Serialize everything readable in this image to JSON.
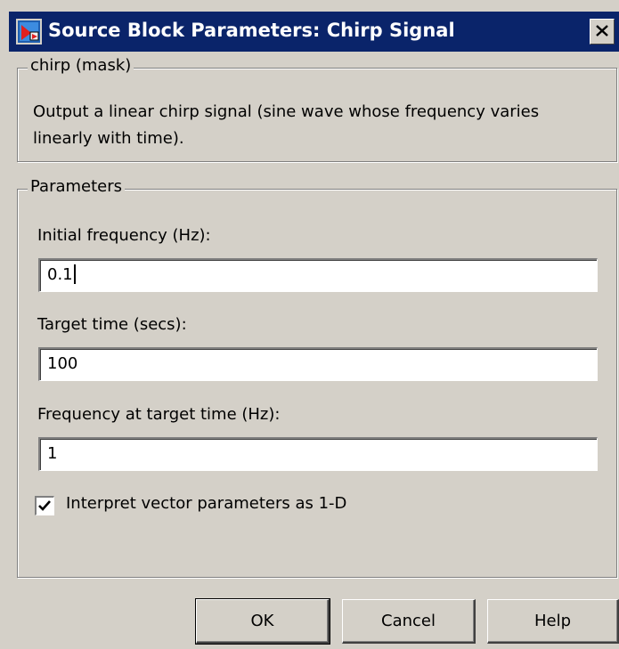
{
  "window": {
    "title": "Source Block Parameters: Chirp Signal",
    "close_label": "✕"
  },
  "mask_group": {
    "legend": "chirp (mask)",
    "description": "Output a linear chirp signal (sine wave  whose frequency varies linearly with time)."
  },
  "parameters": {
    "legend": "Parameters",
    "initial_frequency": {
      "label": "Initial frequency (Hz):",
      "value": "0.1"
    },
    "target_time": {
      "label": "Target time (secs):",
      "value": "100"
    },
    "frequency_at_target": {
      "label": "Frequency at target time (Hz):",
      "value": "1"
    },
    "interpret_vector": {
      "label": "Interpret vector parameters as 1-D",
      "checked": true
    }
  },
  "buttons": {
    "ok": "OK",
    "cancel": "Cancel",
    "help": "Help"
  },
  "colors": {
    "titlebar": "#0a246a",
    "dialog_face": "#d4d0c8"
  }
}
